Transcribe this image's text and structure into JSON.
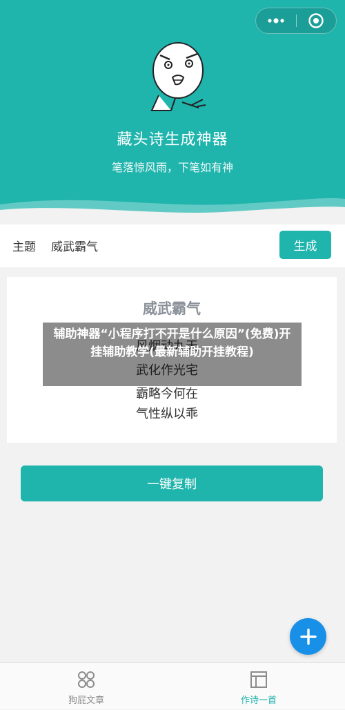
{
  "colors": {
    "primary": "#1fb4ac",
    "fab": "#1890e8",
    "tab_active": "#1fb4ac",
    "tab_inactive": "#8c8c8c"
  },
  "header": {
    "title": "藏头诗生成神器",
    "subtitle": "笔落惊风雨，下笔如有神"
  },
  "capsule": {
    "more_icon": "more-dots-icon",
    "close_icon": "target-close-icon"
  },
  "form": {
    "label": "主题",
    "value": "威武霸气",
    "generate_label": "生成"
  },
  "poem": {
    "title": "威武霸气",
    "lines": [
      "风烟动九天",
      "武化作光宅",
      "霸略今何在",
      "气性纵以乖"
    ]
  },
  "overlay_text": "辅助神器“小程序打不开是什么原因”(免费)开挂辅助教学(最新辅助开挂教程)",
  "copy_label": "一键复制",
  "fab_icon": "plus-icon",
  "tabs": [
    {
      "label": "狗屁文章",
      "icon": "circles-icon",
      "active": false
    },
    {
      "label": "作诗一首",
      "icon": "layout-icon",
      "active": true
    }
  ]
}
